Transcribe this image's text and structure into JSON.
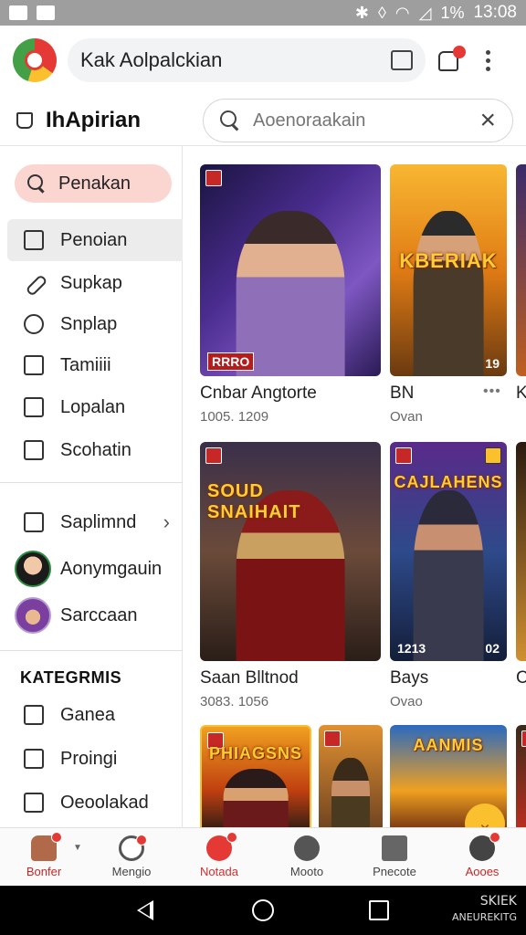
{
  "status_bar": {
    "battery": "1%",
    "time": "13:08"
  },
  "browser": {
    "url_text": "Kak Aolpalckian"
  },
  "header": {
    "title": "IhApirian",
    "search_placeholder": "Aoenoraakain"
  },
  "sidebar": {
    "search_pill": "Penakan",
    "items": [
      {
        "label": "Penoian",
        "icon": "edit-icon"
      },
      {
        "label": "Supkap",
        "icon": "link-icon"
      },
      {
        "label": "Snplap",
        "icon": "search-circle-icon"
      },
      {
        "label": "Tamiiii",
        "icon": "check-box-icon"
      },
      {
        "label": "Lopalan",
        "icon": "trend-icon"
      },
      {
        "label": "Scohatin",
        "icon": "bag-icon"
      }
    ],
    "account_items": [
      {
        "label": "Saplimnd",
        "icon": "camera-icon"
      },
      {
        "label": "Aonymgauin",
        "icon": "avatar"
      },
      {
        "label": "Sarccaan",
        "icon": "avatar"
      }
    ],
    "section_title": "KATEGRMIS",
    "category_items": [
      {
        "label": "Ganea",
        "icon": "dice-icon"
      },
      {
        "label": "Proingi",
        "icon": "chart-icon"
      },
      {
        "label": "Oeoolakad",
        "icon": "home-icon"
      }
    ]
  },
  "grid": {
    "row1": [
      {
        "name": "Cnbar Angtorte",
        "meta": "1005. 1209",
        "corner_left": "RRRO",
        "corner_right": ""
      },
      {
        "name": "BN",
        "meta": "Ovan",
        "art_title": "KBERIAK",
        "corner_right": "19"
      },
      {
        "name": "K",
        "meta": ""
      }
    ],
    "row2": [
      {
        "name": "Saan Blltnod",
        "meta": "3083. 1056",
        "art_title": "SOUD SNAIHAIT",
        "corner_left": ""
      },
      {
        "name": "Bays",
        "meta": "Ovao",
        "art_title": "CAJLAHENS",
        "corner_left": "1213",
        "corner_right": "02"
      },
      {
        "name": "C",
        "meta": ""
      }
    ],
    "row3": [
      {
        "art_title": "PHIAGSNS"
      },
      {
        "art_title": ""
      },
      {
        "art_title": "AANMIS"
      }
    ],
    "more_dots": "•••"
  },
  "bottom_nav": [
    {
      "label": "Bonfer"
    },
    {
      "label": "Mengio"
    },
    {
      "label": "Notada"
    },
    {
      "label": "Mooto"
    },
    {
      "label": "Pnecote"
    },
    {
      "label": "Aooes"
    }
  ],
  "watermark": {
    "line1": "SKIEK",
    "line2": "ANEUREKITG"
  },
  "colors": {
    "accent": "#e53935",
    "pill_bg": "#fbd5d0",
    "active_bg": "#ececec",
    "status_bar": "#9e9e9e"
  }
}
